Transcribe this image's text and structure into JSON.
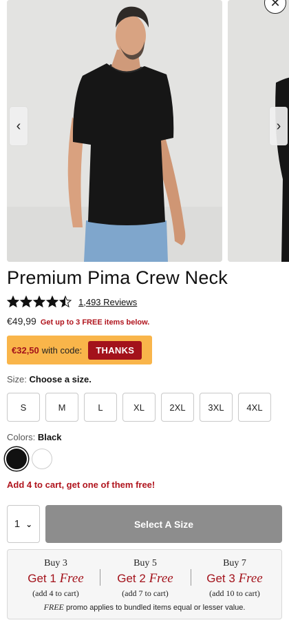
{
  "product": {
    "title": "Premium Pima Crew Neck",
    "rating": 4.5,
    "rating_max": 5,
    "reviews": "1,493 Reviews",
    "price": "€49,99",
    "promo_line": "Get up to 3 FREE items below.",
    "code_price": "€32,50",
    "code_text": "with code:",
    "code": "THANKS"
  },
  "size": {
    "label": "Size:",
    "prompt": "Choose a size.",
    "options": [
      "S",
      "M",
      "L",
      "XL",
      "2XL",
      "3XL",
      "4XL"
    ]
  },
  "colors": {
    "label": "Colors:",
    "selected": "Black",
    "swatches": [
      "#111111",
      "#ffffff"
    ]
  },
  "offer": "Add 4 to cart, get one of them free!",
  "cart": {
    "quantity": "1",
    "button": "Select A Size"
  },
  "bundle": {
    "tiers": [
      {
        "buy": "Buy 3",
        "get": "Get 1",
        "free": "Free",
        "add": "(add 4 to cart)"
      },
      {
        "buy": "Buy 5",
        "get": "Get 2",
        "free": "Free",
        "add": "(add 7 to cart)"
      },
      {
        "buy": "Buy 7",
        "get": "Get 3",
        "free": "Free",
        "add": "(add 10 to cart)"
      }
    ],
    "footer_free": "FREE",
    "footer_text": "promo applies to bundled items equal or lesser value."
  },
  "icons": {
    "prev": "chevron-left-icon",
    "next": "chevron-right-icon",
    "close": "close-icon",
    "star": "star-icon"
  },
  "theme": {
    "accent_red": "#a3121b",
    "code_bg": "#f9b54a",
    "disabled_btn": "#8d8d8d"
  }
}
